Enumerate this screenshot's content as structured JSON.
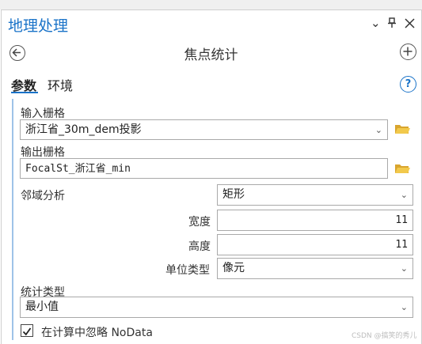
{
  "header": {
    "title": "地理处理",
    "tool_name": "焦点统计"
  },
  "tabs": [
    "参数",
    "环境"
  ],
  "help_glyph": "?",
  "params": {
    "input_raster": {
      "label": "输入栅格",
      "value": "浙江省_30m_dem投影"
    },
    "output_raster": {
      "label": "输出栅格",
      "value": "FocalSt_浙江省_min"
    },
    "neighborhood": {
      "label": "邻域分析",
      "value": "矩形"
    },
    "width": {
      "label": "宽度",
      "value": "11"
    },
    "height": {
      "label": "高度",
      "value": "11"
    },
    "units": {
      "label": "单位类型",
      "value": "像元"
    },
    "stat_type": {
      "label": "统计类型",
      "value": "最小值"
    },
    "ignore_nodata": {
      "label": "在计算中忽略 NoData",
      "checked": true
    }
  },
  "watermark": "CSDN @搞笑的秀儿",
  "colors": {
    "accent": "#1a73c8",
    "folder": "#e0b03a"
  }
}
